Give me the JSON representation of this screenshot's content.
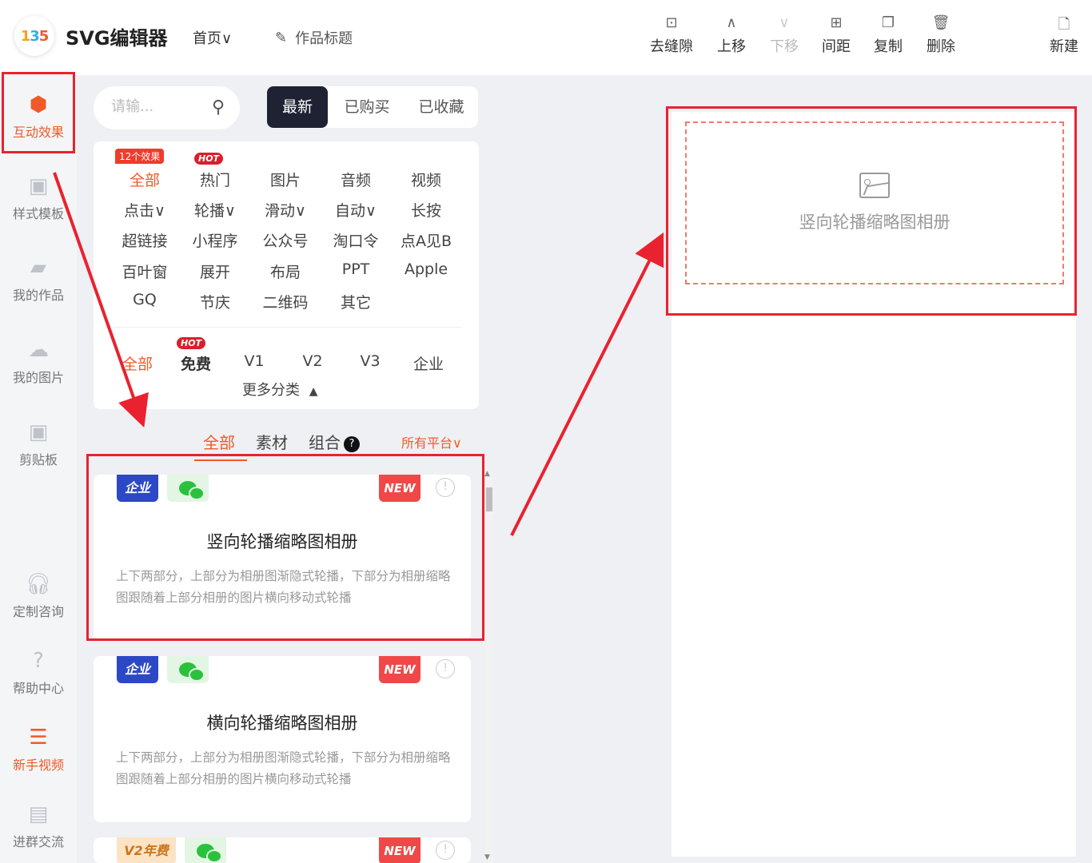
{
  "header": {
    "logo_text": [
      "1",
      "3",
      "5"
    ],
    "app_title": "SVG编辑器",
    "home_menu": "首页∨",
    "work_title": "作品标题",
    "tools": [
      {
        "label": "去缝隙",
        "icon": "⊡",
        "disabled": false
      },
      {
        "label": "上移",
        "icon": "∧",
        "disabled": false
      },
      {
        "label": "下移",
        "icon": "∨",
        "disabled": true
      },
      {
        "label": "间距",
        "icon": "⊞",
        "disabled": false
      },
      {
        "label": "复制",
        "icon": "❐",
        "disabled": false
      },
      {
        "label": "删除",
        "icon": "🗑",
        "disabled": false
      }
    ],
    "new_label": "新建"
  },
  "leftnav": {
    "items": [
      {
        "label": "互动效果"
      },
      {
        "label": "样式模板"
      },
      {
        "label": "我的作品"
      },
      {
        "label": "我的图片"
      },
      {
        "label": "剪贴板"
      },
      {
        "label": "定制咨询"
      },
      {
        "label": "帮助中心"
      },
      {
        "label": "新手视频"
      },
      {
        "label": "进群交流"
      }
    ]
  },
  "panel": {
    "search_placeholder": "请输...",
    "segments": [
      "最新",
      "已购买",
      "已收藏"
    ],
    "count_badge": "12个效果",
    "hot_badge": "HOT",
    "categories": [
      "全部",
      "热门",
      "图片",
      "音频",
      "视频",
      "点击∨",
      "轮播∨",
      "滑动∨",
      "自动∨",
      "长按",
      "超链接",
      "小程序",
      "公众号",
      "淘口令",
      "点A见B",
      "百叶窗",
      "展开",
      "布局",
      "PPT",
      "Apple",
      "GQ",
      "节庆",
      "二维码",
      "其它"
    ],
    "versions": [
      "全部",
      "免费",
      "V1",
      "V2",
      "V3",
      "企业"
    ],
    "more": "更多分类",
    "sub_tabs": [
      "全部",
      "素材",
      "组合"
    ],
    "help_mark": "?",
    "platform": "所有平台∨",
    "cards": [
      {
        "tag": "企业",
        "badge": "NEW",
        "title": "竖向轮播缩略图相册",
        "desc": "上下两部分，上部分为相册图渐隐式轮播，下部分为相册缩略图跟随着上部分相册的图片横向移动式轮播"
      },
      {
        "tag": "企业",
        "badge": "NEW",
        "title": "横向轮播缩略图相册",
        "desc": "上下两部分，上部分为相册图渐隐式轮播，下部分为相册缩略图跟随着上部分相册的图片横向移动式轮播"
      },
      {
        "tag": "V2年费",
        "badge": "NEW"
      }
    ]
  },
  "canvas": {
    "placeholder_label": "竖向轮播缩略图相册"
  },
  "colors": {
    "accent": "#f05a28",
    "annotation": "#e8232f",
    "segment_active": "#1e2233"
  }
}
